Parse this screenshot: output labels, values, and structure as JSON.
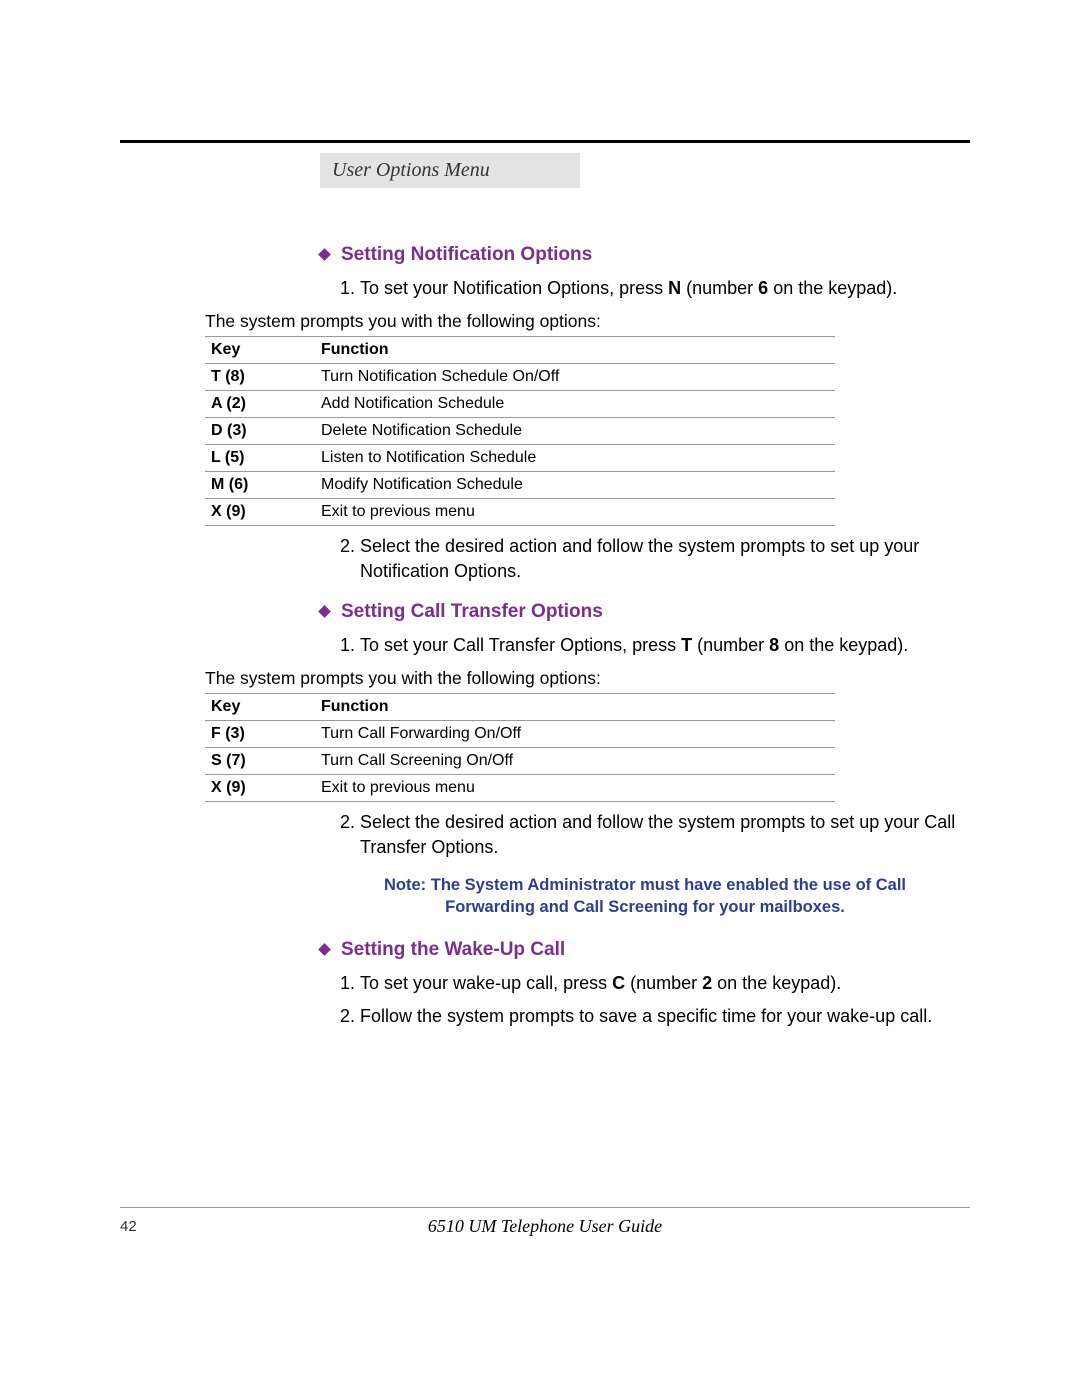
{
  "header": {
    "title": "User Options Menu"
  },
  "sections": [
    {
      "title": "Setting Notification Options",
      "steps": [
        {
          "pre": "To set your Notification Options, press ",
          "key": "N",
          "mid": " (number ",
          "num": "6",
          "post": " on the keypad)."
        },
        {
          "text": "Select the desired action and follow the system prompts to set up your Notification Options."
        }
      ],
      "prompt": "The system prompts you with the following options:",
      "table": {
        "head": {
          "key": "Key",
          "func": "Function"
        },
        "rows": [
          {
            "key": "T (8)",
            "func": "Turn Notification Schedule On/Off"
          },
          {
            "key": "A (2)",
            "func": "Add Notification Schedule"
          },
          {
            "key": "D (3)",
            "func": "Delete Notification Schedule"
          },
          {
            "key": "L (5)",
            "func": "Listen to Notification Schedule"
          },
          {
            "key": "M (6)",
            "func": "Modify Notification Schedule"
          },
          {
            "key": "X (9)",
            "func": "Exit to previous menu"
          }
        ]
      }
    },
    {
      "title": "Setting Call Transfer Options",
      "steps": [
        {
          "pre": "To set your Call Transfer Options, press ",
          "key": "T",
          "mid": " (number ",
          "num": "8",
          "post": " on the keypad)."
        },
        {
          "text": "Select the desired action and follow the system prompts to set up your Call Transfer Options."
        }
      ],
      "prompt": "The system prompts you with the following options:",
      "table": {
        "head": {
          "key": "Key",
          "func": "Function"
        },
        "rows": [
          {
            "key": "F (3)",
            "func": "Turn Call Forwarding On/Off"
          },
          {
            "key": "S (7)",
            "func": "Turn Call Screening On/Off"
          },
          {
            "key": "X (9)",
            "func": "Exit to previous menu"
          }
        ]
      },
      "note": "Note: The System Administrator must have enabled the use of Call Forwarding and Call Screening for your mailboxes."
    },
    {
      "title": "Setting the Wake-Up Call",
      "steps": [
        {
          "pre": "To set your wake-up call, press ",
          "key": "C",
          "mid": " (number ",
          "num": "2",
          "post": " on the keypad)."
        },
        {
          "text": "Follow the system prompts to save a specific time for your wake-up call."
        }
      ]
    }
  ],
  "footer": {
    "page": "42",
    "title": "6510 UM Telephone User Guide"
  }
}
